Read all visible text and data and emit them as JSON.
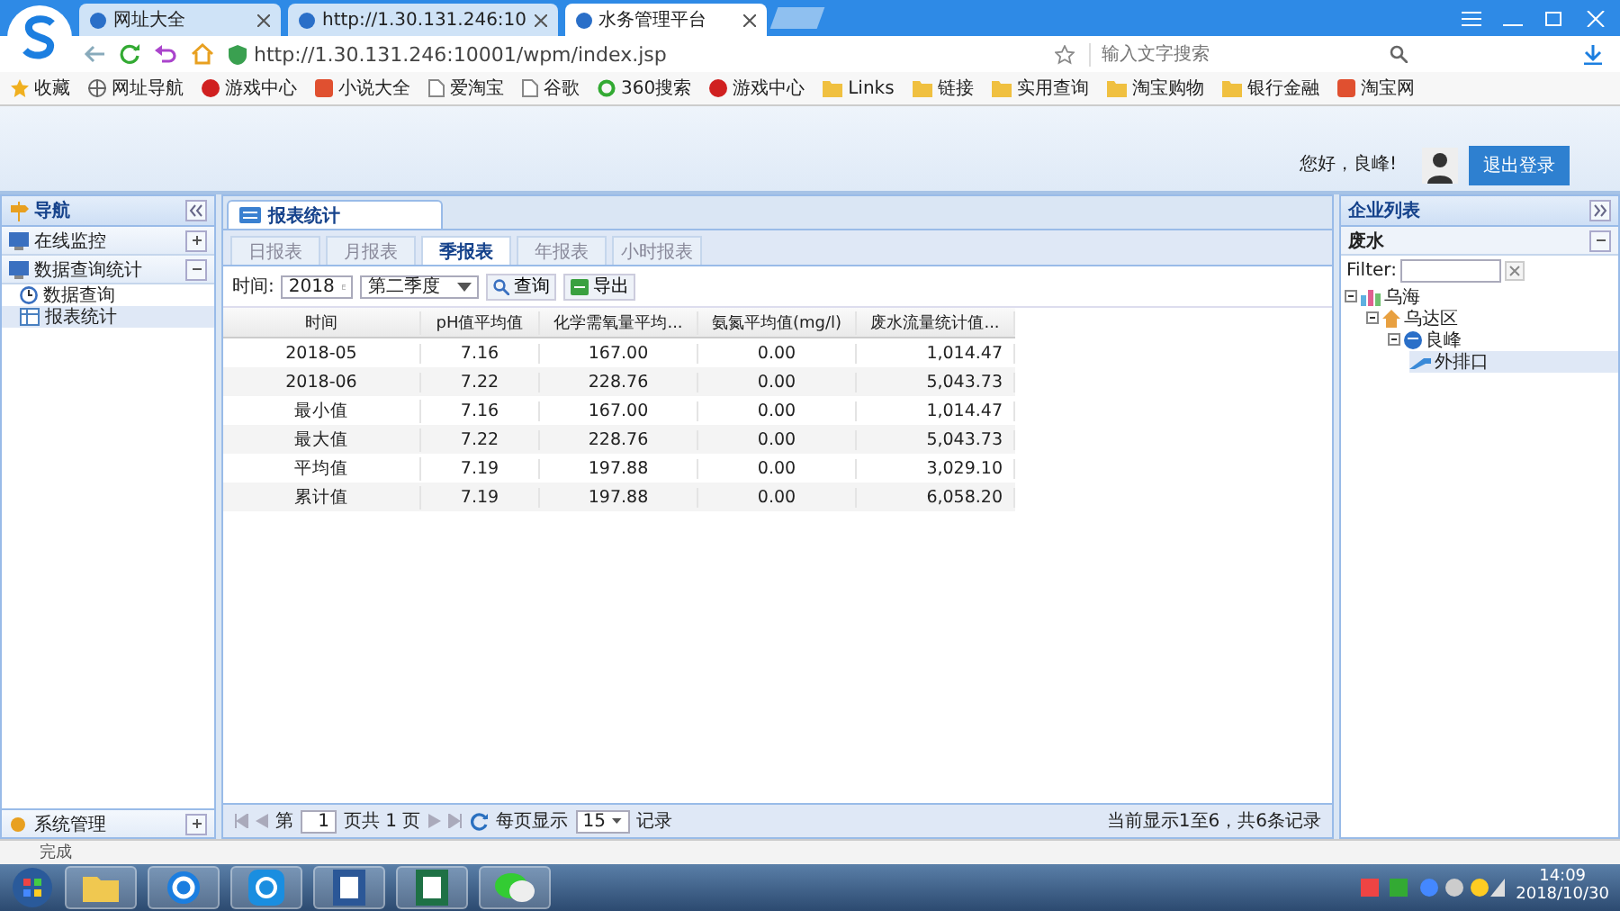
{
  "browser": {
    "tabs": [
      {
        "title": "网址大全",
        "selected": false
      },
      {
        "title": "http://1.30.131.246:10",
        "selected": false
      },
      {
        "title": "水务管理平台",
        "selected": true
      }
    ],
    "url": "http://1.30.131.246:10001/wpm/index.jsp",
    "search_placeholder": "输入文字搜索",
    "bookmarks": [
      {
        "label": "收藏",
        "kind": "star"
      },
      {
        "label": "网址导航",
        "kind": "globe"
      },
      {
        "label": "游戏中心",
        "kind": "game"
      },
      {
        "label": "小说大全",
        "kind": "book"
      },
      {
        "label": "爱淘宝",
        "kind": "page"
      },
      {
        "label": "谷歌",
        "kind": "page"
      },
      {
        "label": "360搜索",
        "kind": "ring"
      },
      {
        "label": "游戏中心",
        "kind": "game"
      },
      {
        "label": "Links",
        "kind": "folder"
      },
      {
        "label": "链接",
        "kind": "folder"
      },
      {
        "label": "实用查询",
        "kind": "folder"
      },
      {
        "label": "淘宝购物",
        "kind": "folder"
      },
      {
        "label": "银行金融",
        "kind": "folder"
      },
      {
        "label": "淘宝网",
        "kind": "book"
      }
    ]
  },
  "header": {
    "greeting": "您好，良峰!",
    "logout": "退出登录"
  },
  "nav": {
    "title": "导航",
    "items": [
      {
        "label": "在线监控",
        "expanded": false
      },
      {
        "label": "数据查询统计",
        "expanded": true,
        "children": [
          {
            "label": "数据查询",
            "selected": false
          },
          {
            "label": "报表统计",
            "selected": true
          }
        ]
      }
    ],
    "bottom": "系统管理"
  },
  "content": {
    "tab": "报表统计",
    "report_tabs": [
      {
        "label": "日报表",
        "selected": false
      },
      {
        "label": "月报表",
        "selected": false
      },
      {
        "label": "季报表",
        "selected": true
      },
      {
        "label": "年报表",
        "selected": false
      },
      {
        "label": "小时报表",
        "selected": false
      }
    ],
    "filter": {
      "label": "时间:",
      "year": "2018",
      "quarter": "第二季度",
      "query": "查询",
      "export": "导出"
    },
    "table": {
      "columns": [
        "时间",
        "pH值平均值",
        "化学需氧量平均...",
        "氨氮平均值(mg/l)",
        "废水流量统计值..."
      ],
      "rows": [
        [
          "2018-05",
          "7.16",
          "167.00",
          "0.00",
          "1,014.47"
        ],
        [
          "2018-06",
          "7.22",
          "228.76",
          "0.00",
          "5,043.73"
        ],
        [
          "最小值",
          "7.16",
          "167.00",
          "0.00",
          "1,014.47"
        ],
        [
          "最大值",
          "7.22",
          "228.76",
          "0.00",
          "5,043.73"
        ],
        [
          "平均值",
          "7.19",
          "197.88",
          "0.00",
          "3,029.10"
        ],
        [
          "累计值",
          "7.19",
          "197.88",
          "0.00",
          "6,058.20"
        ]
      ]
    },
    "pager": {
      "page_prefix": "第",
      "page": "1",
      "page_suffix": "页共 1 页",
      "per_page_label": "每页显示",
      "per_page": "15",
      "records": "记录",
      "summary": "当前显示1至6，共6条记录"
    }
  },
  "company_panel": {
    "title": "企业列表",
    "section": "废水",
    "filter_label": "Filter:",
    "tree": [
      {
        "label": "乌海",
        "kind": "region",
        "expanded": true,
        "selected": false,
        "children": [
          {
            "label": "乌达区",
            "kind": "district",
            "expanded": true,
            "selected": false,
            "children": [
              {
                "label": "良峰",
                "kind": "company",
                "expanded": true,
                "selected": false,
                "children": [
                  {
                    "label": "外排口",
                    "kind": "outlet",
                    "selected": true
                  }
                ]
              }
            ]
          }
        ]
      }
    ]
  },
  "status_bar": "完成",
  "taskbar": {
    "time": "14:09",
    "date": "2018/10/30"
  }
}
